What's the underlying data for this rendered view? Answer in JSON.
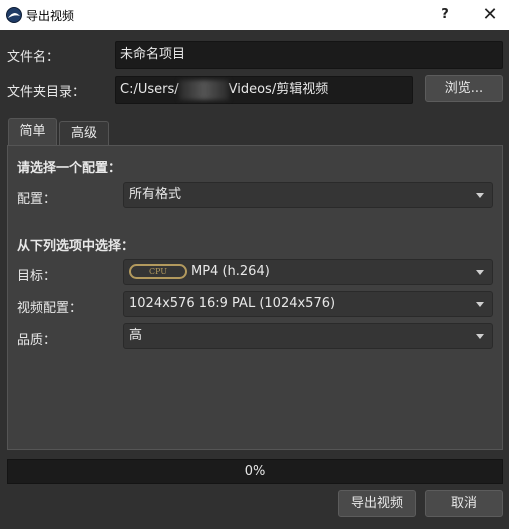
{
  "window": {
    "title": "导出视频",
    "help_label": "?",
    "close_label": "✕"
  },
  "filename": {
    "label": "文件名：",
    "value": "未命名项目"
  },
  "folder": {
    "label": "文件夹目录：",
    "value_prefix": "C:/Users/",
    "value_suffix": "Videos/剪辑视频",
    "browse_label": "浏览..."
  },
  "tabs": [
    {
      "label": "简单",
      "active": true
    },
    {
      "label": "高级",
      "active": false
    }
  ],
  "profile_section": {
    "heading": "请选择一个配置：",
    "label": "配置：",
    "value": "所有格式"
  },
  "options_section": {
    "heading": "从下列选项中选择：",
    "target": {
      "label": "目标：",
      "badge": "CPU",
      "value": "MP4 (h.264)"
    },
    "video_profile": {
      "label": "视频配置：",
      "value": "1024x576 16:9 PAL (1024x576)"
    },
    "quality": {
      "label": "品质：",
      "value": "高"
    }
  },
  "progress": {
    "value_percent": 0,
    "text": "0%"
  },
  "buttons": {
    "export": "导出视频",
    "cancel": "取消"
  },
  "colors": {
    "background": "#303030",
    "panel": "#404040",
    "field": "#1b1b1b",
    "accent_badge": "#b39a5e"
  }
}
